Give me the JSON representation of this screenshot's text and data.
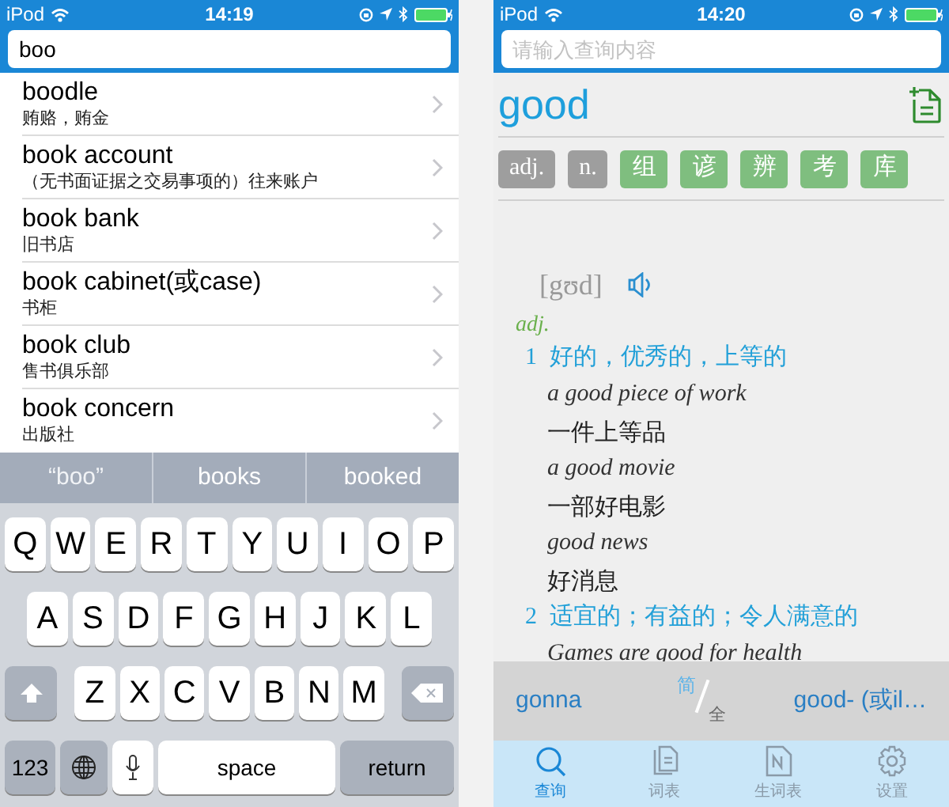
{
  "left_screen": {
    "status_bar": {
      "carrier": "iPod",
      "time": "14:19"
    },
    "search": {
      "value": "boo"
    },
    "results": [
      {
        "word": "boodle",
        "meaning": "贿赂，贿金"
      },
      {
        "word": "book account",
        "meaning": "（无书面证据之交易事项的）往来账户"
      },
      {
        "word": "book bank",
        "meaning": "旧书店"
      },
      {
        "word": "book cabinet(或case)",
        "meaning": "书柜"
      },
      {
        "word": "book club",
        "meaning": "售书俱乐部"
      },
      {
        "word": "book concern",
        "meaning": "出版社"
      }
    ],
    "suggestions": [
      {
        "text": "“boo”",
        "kind": "typed"
      },
      {
        "text": "books",
        "kind": "word"
      },
      {
        "text": "booked",
        "kind": "word"
      }
    ],
    "keyboard": {
      "rows": [
        {
          "keys": [
            {
              "kind": "letter",
              "label": "Q"
            },
            {
              "kind": "letter",
              "label": "W"
            },
            {
              "kind": "letter",
              "label": "E"
            },
            {
              "kind": "letter",
              "label": "R"
            },
            {
              "kind": "letter",
              "label": "T"
            },
            {
              "kind": "letter",
              "label": "Y"
            },
            {
              "kind": "letter",
              "label": "U"
            },
            {
              "kind": "letter",
              "label": "I"
            },
            {
              "kind": "letter",
              "label": "O"
            },
            {
              "kind": "letter",
              "label": "P"
            }
          ]
        },
        {
          "keys": [
            {
              "kind": "letter",
              "label": "A"
            },
            {
              "kind": "letter",
              "label": "S"
            },
            {
              "kind": "letter",
              "label": "D"
            },
            {
              "kind": "letter",
              "label": "F"
            },
            {
              "kind": "letter",
              "label": "G"
            },
            {
              "kind": "letter",
              "label": "H"
            },
            {
              "kind": "letter",
              "label": "J"
            },
            {
              "kind": "letter",
              "label": "K"
            },
            {
              "kind": "letter",
              "label": "L"
            }
          ]
        },
        {
          "keys": [
            {
              "kind": "shift"
            },
            {
              "kind": "letter",
              "label": "Z"
            },
            {
              "kind": "letter",
              "label": "X"
            },
            {
              "kind": "letter",
              "label": "C"
            },
            {
              "kind": "letter",
              "label": "V"
            },
            {
              "kind": "letter",
              "label": "B"
            },
            {
              "kind": "letter",
              "label": "N"
            },
            {
              "kind": "letter",
              "label": "M"
            },
            {
              "kind": "delete"
            }
          ]
        },
        {
          "keys": [
            {
              "kind": "numbers",
              "label": "123"
            },
            {
              "kind": "globe"
            },
            {
              "kind": "mic"
            },
            {
              "kind": "space",
              "label": "space"
            },
            {
              "kind": "return",
              "label": "return"
            }
          ]
        }
      ]
    }
  },
  "right_screen": {
    "status_bar": {
      "carrier": "iPod",
      "time": "14:20"
    },
    "search": {
      "placeholder": "请输入查询内容"
    },
    "headword": "good",
    "tags": [
      {
        "label": "adj.",
        "kind": "pos"
      },
      {
        "label": "n.",
        "kind": "pos"
      },
      {
        "label": "组",
        "kind": "section"
      },
      {
        "label": "谚",
        "kind": "section"
      },
      {
        "label": "辨",
        "kind": "section"
      },
      {
        "label": "考",
        "kind": "section"
      },
      {
        "label": "库",
        "kind": "section"
      }
    ],
    "phonetic": "[gʊd]",
    "entry": {
      "pos": "adj.",
      "senses": [
        {
          "number": "1",
          "definition": "好的，优秀的，上等的",
          "examples": [
            {
              "en": "a good piece of work",
              "zh": "一件上等品"
            },
            {
              "en": "a good movie",
              "zh": "一部好电影"
            },
            {
              "en": "good news",
              "zh": "好消息"
            }
          ]
        },
        {
          "number": "2",
          "definition": "适宜的；有益的；令人满意的",
          "examples": [
            {
              "en": "Games are good for health"
            }
          ]
        }
      ]
    },
    "navigator": {
      "previous": "gonna",
      "script_top": "简",
      "script_bottom": "全",
      "next": "good- (或il…"
    },
    "tabs": [
      {
        "label": "查询",
        "kind": "search",
        "selected": true
      },
      {
        "label": "词表",
        "kind": "list",
        "selected": false
      },
      {
        "label": "生词表",
        "kind": "notebook",
        "selected": false
      },
      {
        "label": "设置",
        "kind": "settings",
        "selected": false
      }
    ]
  }
}
